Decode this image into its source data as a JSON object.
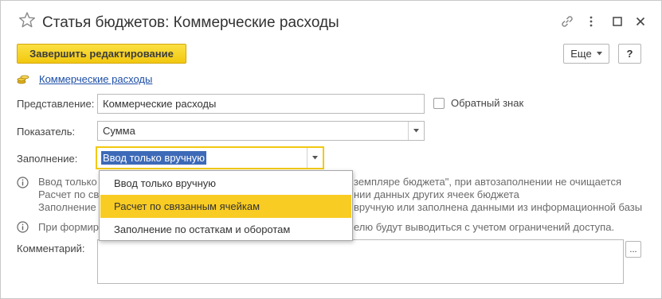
{
  "window": {
    "title": "Статья бюджетов: Коммерческие расходы",
    "icons": [
      "star-icon",
      "link-icon",
      "more-vert-icon",
      "maximize-icon",
      "close-icon"
    ]
  },
  "toolbar": {
    "finish_label": "Завершить редактирование",
    "more_label": "Еще",
    "help_label": "?"
  },
  "breadcrumb": {
    "icon": "coins-icon",
    "link_text": "Коммерческие расходы"
  },
  "form": {
    "representation_label": "Представление:",
    "representation_value": "Коммерческие расходы",
    "reverse_sign_label": "Обратный знак",
    "reverse_sign_checked": false,
    "indicator_label": "Показатель:",
    "indicator_value": "Сумма",
    "filling_label": "Заполнение:",
    "filling_value": "Ввод только вручную",
    "comment_label": "Комментарий:",
    "comment_value": "",
    "comment_button": "..."
  },
  "info": {
    "block1": [
      "Ввод только",
      "Расчет по св",
      "Заполнение"
    ],
    "block1_right": [
      "земпляре бюджета\", при автозаполнении не очищается",
      "нии данных других ячеек бюджета",
      "вручную или заполнена данными из информационной базы"
    ],
    "block2_left": "При формир",
    "block2_right": "елю будут выводиться с учетом ограничений доступа."
  },
  "dropdown": {
    "items": [
      "Ввод только вручную",
      "Расчет по связанным ячейкам",
      "Заполнение по остаткам и оборотам"
    ],
    "highlighted_index": 1
  },
  "colors": {
    "accent": "#f2c80f",
    "highlight": "#f9cc23",
    "selection": "#3d6ab8",
    "link": "#1c4ea7"
  }
}
